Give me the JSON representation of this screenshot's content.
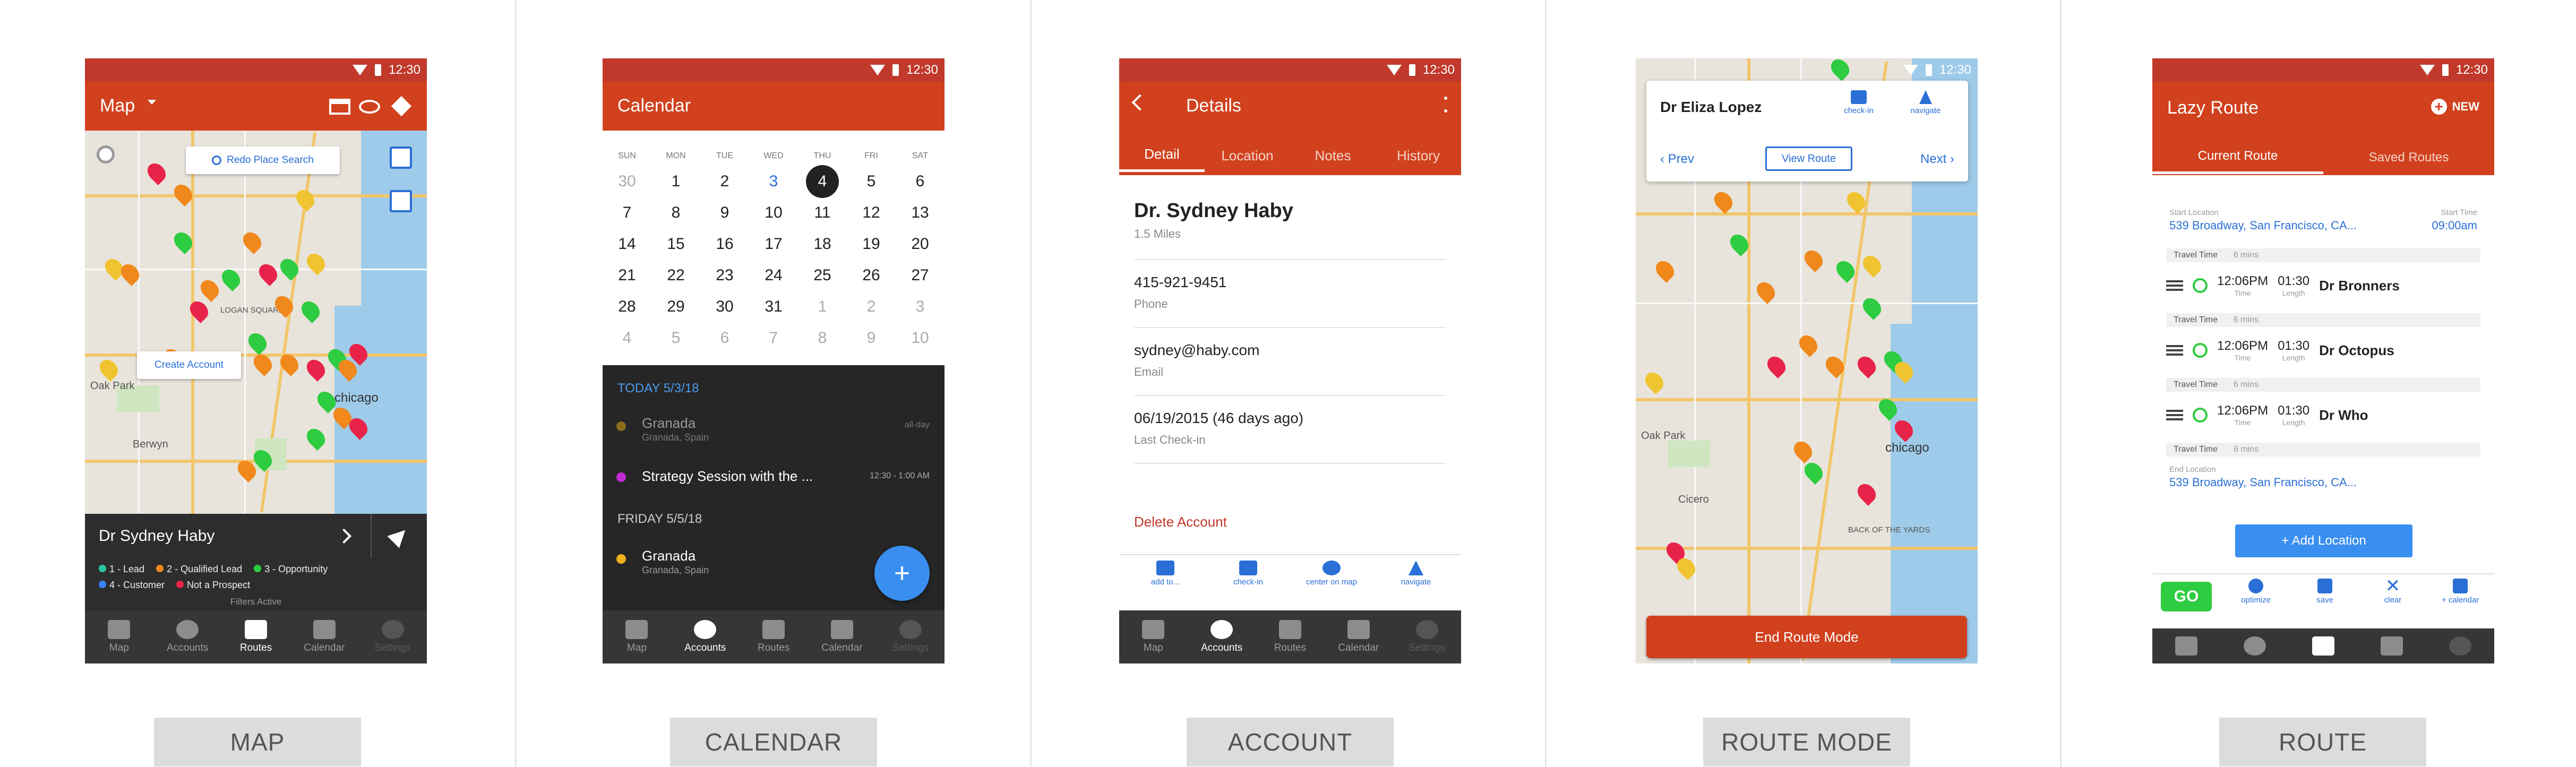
{
  "status": {
    "time": "12:30"
  },
  "captions": [
    "MAP",
    "CALENDAR",
    "ACCOUNT",
    "ROUTE MODE",
    "ROUTE"
  ],
  "nav": [
    "Map",
    "Accounts",
    "Routes",
    "Calendar",
    "Settings"
  ],
  "map": {
    "title": "Map",
    "redo_search": "Redo Place Search",
    "create_account": "Create Account",
    "selected_name": "Dr Sydney Haby",
    "legend": [
      "1 - Lead",
      "2 - Qualified Lead",
      "3 - Opportunity",
      "4 - Customer",
      "Not a Prospect"
    ],
    "legend_colors": [
      "#27c6a2",
      "#f0881c",
      "#2ecc40",
      "#3b82f6",
      "#e8234a"
    ],
    "filters": "Filters Active",
    "places": [
      "Oak Park",
      "Cicero",
      "Berwyn",
      "chicago",
      "LOGAN SQUARE",
      "BACK OF THE YARDS"
    ]
  },
  "calendar": {
    "title": "Calendar",
    "weekdays": [
      "SUN",
      "MON",
      "TUE",
      "WED",
      "THU",
      "FRI",
      "SAT"
    ],
    "weeks": [
      [
        "30",
        "1",
        "2",
        "3",
        "4",
        "5",
        "6"
      ],
      [
        "7",
        "8",
        "9",
        "10",
        "11",
        "12",
        "13"
      ],
      [
        "14",
        "15",
        "16",
        "17",
        "18",
        "19",
        "20"
      ],
      [
        "21",
        "22",
        "23",
        "24",
        "25",
        "26",
        "27"
      ],
      [
        "28",
        "29",
        "30",
        "31",
        "1",
        "2",
        "3"
      ],
      [
        "4",
        "5",
        "6",
        "7",
        "8",
        "9",
        "10"
      ]
    ],
    "today_header": "TODAY 5/3/18",
    "friday_header": "FRIDAY 5/5/18",
    "events": [
      {
        "title": "Granada",
        "subtitle": "Granada, Spain",
        "time": "all-day",
        "color": "#8a6d1d"
      },
      {
        "title": "Strategy Session with the ...",
        "subtitle": "",
        "time": "12:30 - 1:00 AM",
        "color": "#c02bd6"
      },
      {
        "title": "Granada",
        "subtitle": "Granada, Spain",
        "time": "",
        "color": "#f0b21c"
      }
    ],
    "fab": "+"
  },
  "account": {
    "title": "Details",
    "tabs": [
      "Detail",
      "Location",
      "Notes",
      "History"
    ],
    "name": "Dr. Sydney Haby",
    "distance": "1.5 Miles",
    "phone": "415-921-9451",
    "phone_label": "Phone",
    "email": "sydney@haby.com",
    "email_label": "Email",
    "checkin": "06/19/2015 (46 days ago)",
    "checkin_label": "Last Check-in",
    "delete": "Delete Account",
    "actions": [
      "add to...",
      "check-in",
      "center on map",
      "navigate"
    ]
  },
  "route_mode": {
    "name": "Dr Eliza Lopez",
    "checkin": "check-in",
    "navigate": "navigate",
    "prev": "Prev",
    "view_route": "View Route",
    "next": "Next",
    "end": "End Route Mode"
  },
  "route": {
    "title": "Lazy Route",
    "new": "NEW",
    "tabs": [
      "Current Route",
      "Saved Routes"
    ],
    "start_label": "Start Location",
    "start_value": "539 Broadway, San Francisco, CA...",
    "start_time_label": "Start Time",
    "start_time": "09:00am",
    "travel_label": "Travel Time",
    "travel_value": "6 mins",
    "stops": [
      {
        "time": "12:06PM",
        "time_label": "Time",
        "length": "01:30",
        "length_label": "Length",
        "name": "Dr Bronners"
      },
      {
        "time": "12:06PM",
        "time_label": "Time",
        "length": "01:30",
        "length_label": "Length",
        "name": "Dr Octopus"
      },
      {
        "time": "12:06PM",
        "time_label": "Time",
        "length": "01:30",
        "length_label": "Length",
        "name": "Dr Who"
      }
    ],
    "end_label": "End Location",
    "end_value": "539 Broadway, San Francisco, CA...",
    "add_location": "+ Add Location",
    "go": "GO",
    "actions": [
      "optimize",
      "save",
      "clear",
      "+ calendar"
    ]
  }
}
